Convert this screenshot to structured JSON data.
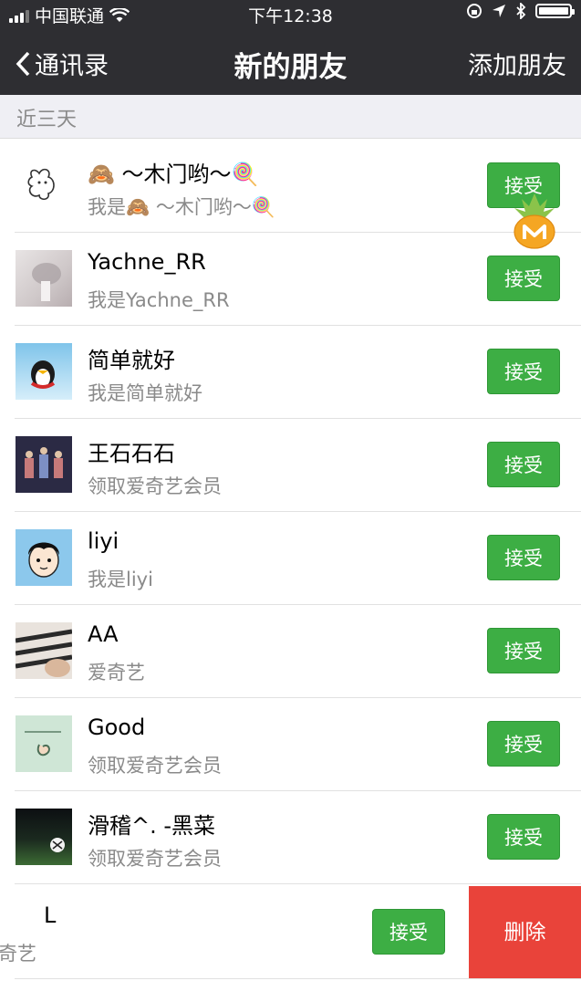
{
  "status_bar": {
    "carrier": "中国联通",
    "time": "下午12:38"
  },
  "nav": {
    "back_label": "通讯录",
    "title": "新的朋友",
    "add_label": "添加朋友"
  },
  "section_header": "近三天",
  "accept_label": "接受",
  "delete_label": "删除",
  "requests": [
    {
      "name": "🙈 ～木门哟～🍭",
      "message": "我是🙈 ～木门哟～🍭"
    },
    {
      "name": "Yachne_RR",
      "message": "我是Yachne_RR"
    },
    {
      "name": "简单就好",
      "message": "我是简单就好"
    },
    {
      "name": "王石石石",
      "message": "领取爱奇艺会员"
    },
    {
      "name": "liyi",
      "message": "我是liyi"
    },
    {
      "name": "AA",
      "message": "爱奇艺"
    },
    {
      "name": "Good",
      "message": "领取爱奇艺会员"
    },
    {
      "name": "滑稽^. -黑菜",
      "message": "领取爱奇艺会员"
    },
    {
      "name": "L",
      "message": "奇艺"
    }
  ],
  "colors": {
    "nav_bg": "#2e2e32",
    "accept_green": "#3dae44",
    "delete_red": "#e9433a"
  }
}
